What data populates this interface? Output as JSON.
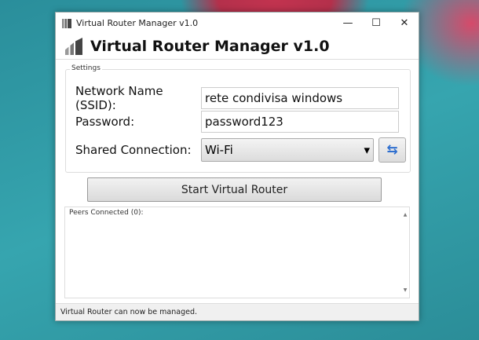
{
  "window": {
    "title": "Virtual Router Manager v1.0",
    "minimize": "—",
    "maximize": "☐",
    "close": "✕"
  },
  "header": {
    "title": "Virtual Router Manager v1.0"
  },
  "settings": {
    "legend": "Settings",
    "ssid_label": "Network Name (SSID):",
    "ssid_value": "rete condivisa windows",
    "password_label": "Password:",
    "password_value": "password123",
    "shared_label": "Shared Connection:",
    "shared_value": "Wi-Fi",
    "dropdown_arrow": "▾",
    "refresh_glyph": "⇆"
  },
  "start_button": "Start Virtual Router",
  "peers": {
    "label": "Peers Connected (0):",
    "scroll_up": "▲",
    "scroll_down": "▼"
  },
  "status": "Virtual Router can now be managed."
}
